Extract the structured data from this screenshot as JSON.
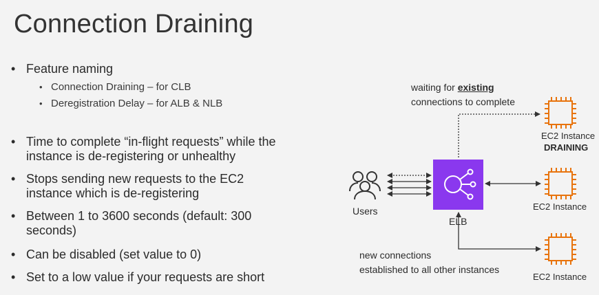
{
  "slide": {
    "title": "Connection Draining"
  },
  "bullets": {
    "feature_naming": "Feature naming",
    "sub1": "Connection Draining – for CLB",
    "sub2": "Deregistration Delay – for ALB & NLB",
    "time_line1": "Time to complete “in-flight requests” while the",
    "time_line2": "instance is de-registering or unhealthy",
    "stops_line1": "Stops sending new requests to the EC2",
    "stops_line2": "instance which is de-registering",
    "between_line1": "Between 1 to 3600 seconds (default: 300",
    "between_line2": "seconds)",
    "disabled": "Can be disabled (set value to 0)",
    "low_value": "Set to a low value if your requests are short"
  },
  "diagram": {
    "waiting_prefix": "waiting for ",
    "waiting_bold": "existing",
    "waiting_line2": "connections to complete",
    "new_line1": "new connections",
    "new_line2": "established to all other instances",
    "users_label": "Users",
    "elb_label": "ELB",
    "instance1_label": "EC2 Instance",
    "instance1_status": "DRAINING",
    "instance2_label": "EC2 Instance",
    "instance3_label": "EC2 Instance",
    "colors": {
      "elb_purple": "#8a38ee",
      "ec2_orange": "#e8730c"
    }
  }
}
